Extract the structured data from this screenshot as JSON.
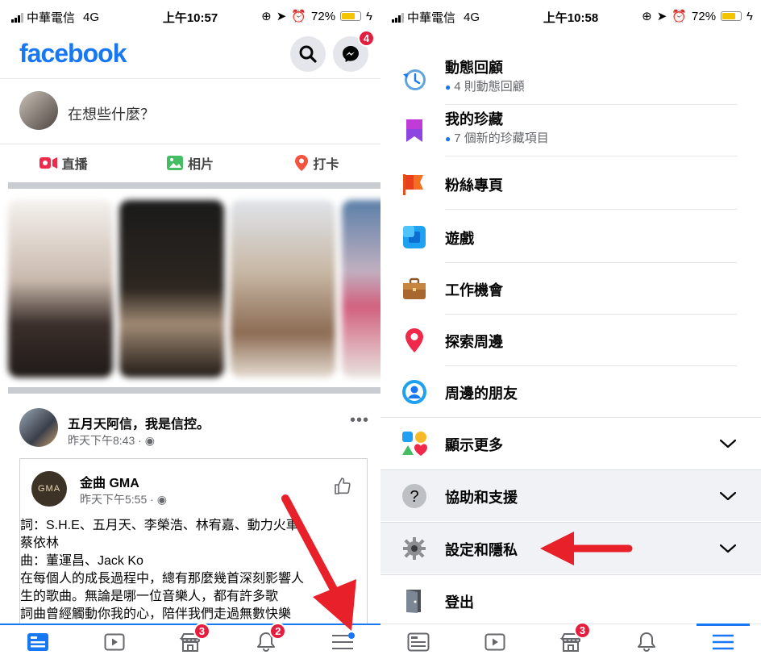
{
  "status_left": {
    "carrier": "中華電信",
    "network": "4G",
    "time": "上午10:57",
    "battery": "72%"
  },
  "status_right": {
    "carrier": "中華電信",
    "network": "4G",
    "time": "上午10:58",
    "battery": "72%"
  },
  "battery_level": 0.72,
  "header": {
    "logo": "facebook",
    "messenger_badge": "4"
  },
  "composer": {
    "prompt": "在想些什麼？"
  },
  "composer_actions": [
    {
      "label": "直播",
      "icon": "live-video-icon",
      "color": "#f02849"
    },
    {
      "label": "相片",
      "icon": "photo-icon",
      "color": "#45bd62"
    },
    {
      "label": "打卡",
      "icon": "check-in-icon",
      "color": "#f5533d"
    }
  ],
  "post": {
    "author": "五月天阿信，我是信控。",
    "time": "昨天下午8:43 · ",
    "shared": {
      "author": "金曲 GMA",
      "avatar_text": "GMA",
      "time": "昨天下午5:55 · ",
      "text": "詞：S.H.E、五月天、李榮浩、林宥嘉、動力火車、\n蔡依林\n曲：董運昌、Jack Ko\n在每個人的成長過程中，總有那麼幾首深刻影響人\n生的歌曲。無論是哪一位音樂人，都有許多歌\n詞曲曾經觸動你我的心，陪伴我們走過無數快樂"
    }
  },
  "tabbar_left": [
    {
      "name": "home",
      "icon": "home-feed-icon",
      "badge": "",
      "active": true
    },
    {
      "name": "watch",
      "icon": "watch-icon",
      "badge": ""
    },
    {
      "name": "marketplace",
      "icon": "marketplace-icon",
      "badge": "3"
    },
    {
      "name": "notifications",
      "icon": "bell-icon",
      "badge": "2"
    },
    {
      "name": "menu",
      "icon": "menu-icon",
      "badge": ""
    }
  ],
  "menu": {
    "items": [
      {
        "label": "動態回顧",
        "sub": "4 則動態回顧",
        "icon": "memories-icon"
      },
      {
        "label": "我的珍藏",
        "sub": "7 個新的珍藏項目",
        "icon": "saved-icon"
      },
      {
        "label": "粉絲專頁",
        "icon": "pages-flag-icon"
      },
      {
        "label": "遊戲",
        "icon": "gaming-icon"
      },
      {
        "label": "工作機會",
        "icon": "jobs-briefcase-icon"
      },
      {
        "label": "探索周邊",
        "icon": "nearby-pin-icon"
      },
      {
        "label": "周邊的朋友",
        "icon": "nearby-friends-icon"
      },
      {
        "label": "顯示更多",
        "icon": "see-more-shapes-icon"
      },
      {
        "label": "協助和支援",
        "icon": "help-icon"
      },
      {
        "label": "設定和隱私",
        "icon": "settings-gear-icon"
      },
      {
        "label": "登出",
        "icon": "logout-door-icon"
      }
    ]
  },
  "tabbar_right": [
    {
      "name": "home",
      "icon": "home-feed-icon",
      "badge": ""
    },
    {
      "name": "watch",
      "icon": "watch-icon",
      "badge": ""
    },
    {
      "name": "marketplace",
      "icon": "marketplace-icon",
      "badge": "3"
    },
    {
      "name": "notifications",
      "icon": "bell-icon",
      "badge": ""
    },
    {
      "name": "menu",
      "icon": "menu-icon",
      "badge": "",
      "active": true
    }
  ],
  "colors": {
    "brand": "#1877f2",
    "badge": "#e41e3f",
    "arrow": "#e8202a"
  }
}
